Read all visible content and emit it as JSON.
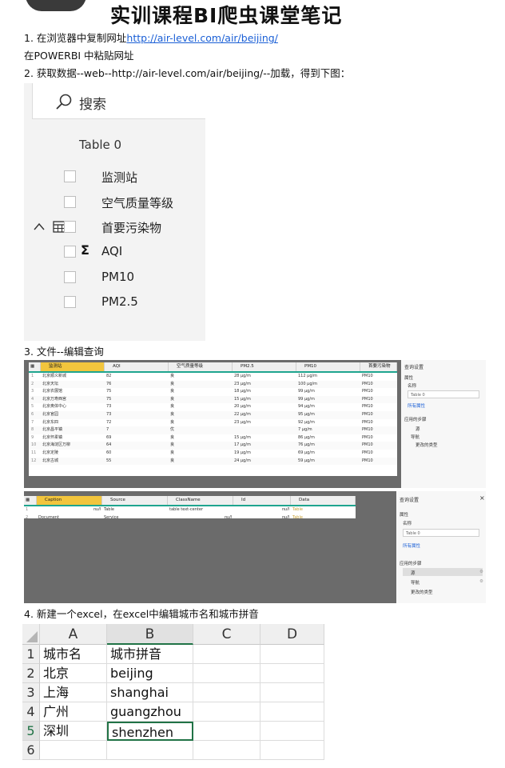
{
  "title": "实训课程BI爬虫课堂笔记",
  "steps": {
    "s1_prefix": "1.   在浏览器中复制网址",
    "s1_url": "http://air-level.com/air/beijing/",
    "s1b": "在POWERBI 中粘贴网址",
    "s2": "2.   获取数据--web--http://air-level.com/air/beijing/--加载，得到下图：",
    "s3": "3.   文件--编辑查询",
    "s4": "4.   新建一个excel，在excel中编辑城市名和城市拼音"
  },
  "fields_panel": {
    "search": "搜索",
    "table_name": "Table 0",
    "fields": [
      {
        "label": "监测站",
        "sigma": false
      },
      {
        "label": "空气质量等级",
        "sigma": false
      },
      {
        "label": "首要污染物",
        "sigma": false
      },
      {
        "label": "AQI",
        "sigma": true
      },
      {
        "label": "PM10",
        "sigma": false
      },
      {
        "label": "PM2.5",
        "sigma": false
      }
    ]
  },
  "query1": {
    "columns": [
      "监测站",
      "AQI",
      "空气质量等级",
      "PM2.5",
      "PM10",
      "首要污染物"
    ],
    "rows": [
      [
        "1",
        "北京顺义新城",
        "82",
        "良",
        "28 μg/m",
        "112 μg/m",
        "PM10"
      ],
      [
        "2",
        "北京天坛",
        "76",
        "良",
        "23 μg/m",
        "100 μg/m",
        "PM10"
      ],
      [
        "3",
        "北京农展馆",
        "75",
        "良",
        "18 μg/m",
        "99 μg/m",
        "PM10"
      ],
      [
        "4",
        "北京万寿西宫",
        "75",
        "良",
        "15 μg/m",
        "99 μg/m",
        "PM10"
      ],
      [
        "5",
        "北京奥体中心",
        "73",
        "良",
        "20 μg/m",
        "94 μg/m",
        "PM10"
      ],
      [
        "6",
        "北京官园",
        "73",
        "良",
        "22 μg/m",
        "95 μg/m",
        "PM10"
      ],
      [
        "7",
        "北京东四",
        "72",
        "良",
        "23 μg/m",
        "92 μg/m",
        "PM10"
      ],
      [
        "8",
        "北京昌平镇",
        "7",
        "优",
        "",
        "7 μg/m",
        "PM10"
      ],
      [
        "9",
        "北京怀柔镇",
        "69",
        "良",
        "15 μg/m",
        "86 μg/m",
        "PM10"
      ],
      [
        "10",
        "北京海淀区万柳",
        "64",
        "良",
        "17 μg/m",
        "76 μg/m",
        "PM10"
      ],
      [
        "11",
        "北京定陵",
        "60",
        "良",
        "19 μg/m",
        "69 μg/m",
        "PM10"
      ],
      [
        "12",
        "北京古城",
        "55",
        "良",
        "24 μg/m",
        "59 μg/m",
        "PM10"
      ]
    ],
    "side": {
      "title": "查询设置",
      "properties": "属性",
      "name_label": "名称",
      "name_value": "Table 0",
      "all_props": "所有属性",
      "steps_title": "应用的步骤",
      "steps": [
        "源",
        "导航",
        "更改的类型"
      ]
    }
  },
  "query2": {
    "columns": [
      "Caption",
      "Source",
      "ClassName",
      "Id",
      "Data"
    ],
    "rows": [
      [
        "1",
        "null",
        "Table",
        "table text-center",
        "null",
        "Table"
      ],
      [
        "2",
        "Document",
        "Service",
        "null",
        "null",
        "Table"
      ]
    ],
    "side": {
      "title": "查询设置",
      "close": "×",
      "properties": "属性",
      "name_label": "名称",
      "name_value": "Table 0",
      "all_props": "所有属性",
      "steps_title": "应用的步骤",
      "steps": [
        "源",
        "导航",
        "更改的类型"
      ]
    }
  },
  "excel": {
    "columns": [
      "A",
      "B",
      "C",
      "D"
    ],
    "rows": [
      [
        "1",
        "城市名",
        "城市拼音"
      ],
      [
        "2",
        "北京",
        "beijing"
      ],
      [
        "3",
        "上海",
        "shanghai"
      ],
      [
        "4",
        "广州",
        "guangzhou"
      ],
      [
        "5",
        "深圳",
        "shenzhen"
      ],
      [
        "6",
        "",
        ""
      ]
    ]
  }
}
